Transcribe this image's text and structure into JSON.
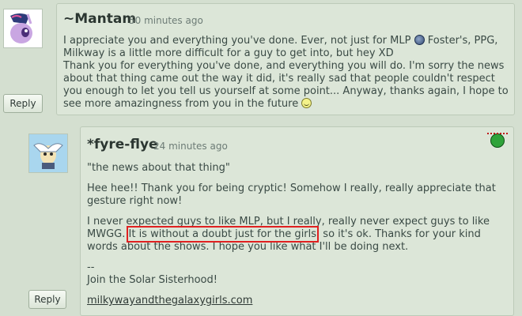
{
  "comments": [
    {
      "author": "~Mantam",
      "time": "50 minutes ago",
      "reply_label": "Reply",
      "paragraphs": [
        {
          "before_icon": "I appreciate you and everything you've done. Ever, not just for MLP",
          "icon": "globe-emoticon",
          "after_icon": "Foster's, PPG, Milkway is a little more difficult for a guy to get into, but hey XD"
        },
        {
          "before_icon": "Thank you for everything you've done, and everything you will do. I'm sorry the news about that thing came out the way it did, it's really sad that people couldn't respect you enough to let you tell us yourself at some point... Anyway, thanks again, I hope to see more amazingness from you in the future",
          "icon": "smile-emoticon",
          "after_icon": ""
        }
      ]
    },
    {
      "author": "*fyre-flye",
      "time": "24 minutes ago",
      "reply_label": "Reply",
      "quote": "\"the news about that thing\"",
      "p2": "Hee hee!! Thank you for being cryptic! Somehow I really, really appreciate that gesture right now!",
      "p3_before": "I never expected guys to like MLP, but I really, really never expect guys to like MWGG.",
      "p3_highlight": "It is without a doubt just for the girls",
      "p3_after": ", so it's ok. Thanks for your kind words about the shows. I hope you like what I'll be doing next.",
      "sig_dash": "--",
      "sig_line": "Join the Solar Sisterhood!",
      "sig_link": "milkywayandthegalaxygirls.com",
      "badge_icon": "deviant-badge-icon"
    }
  ]
}
